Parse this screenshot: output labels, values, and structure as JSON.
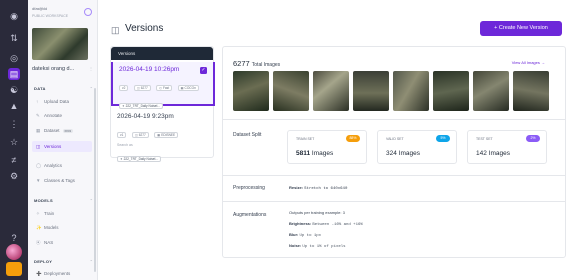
{
  "rail": {
    "icons": [
      "logo-icon",
      "workspaces-icon",
      "universe-icon",
      "projects-icon",
      "models-icon",
      "deploy-icon",
      "workflows-icon",
      "settings-icon"
    ]
  },
  "sidebar": {
    "workspace_label": "dfasfjfdd",
    "workspace_sub": "PUBLIC WORKSPACE",
    "project_name": "dateksi orang d...",
    "data_section": "DATA",
    "data_items": [
      {
        "label": "Upload Data",
        "icon": "upload-icon"
      },
      {
        "label": "Annotate",
        "icon": "annotate-icon"
      },
      {
        "label": "Dataset",
        "icon": "dataset-icon",
        "badge": "6803"
      },
      {
        "label": "Versions",
        "icon": "versions-icon",
        "selected": true
      },
      {
        "label": "Analytics",
        "icon": "analytics-icon"
      },
      {
        "label": "Classes & Tags",
        "icon": "tags-icon"
      }
    ],
    "models_section": "MODELS",
    "models_items": [
      {
        "label": "Train",
        "icon": "train-icon"
      },
      {
        "label": "Models",
        "icon": "models-icon"
      },
      {
        "label": "NAS",
        "icon": "nas-icon"
      }
    ],
    "deploy_section": "DEPLOY",
    "deploy_items": [
      {
        "label": "Deployments",
        "icon": "deployments-icon"
      }
    ]
  },
  "header": {
    "title": "Versions",
    "create_button": "+ Create New Version"
  },
  "versions": {
    "list_header": "Versions",
    "items": [
      {
        "name": "2026-04-19 10:26pm",
        "selected": true,
        "pills": [
          "v2",
          "6277",
          "Fast",
          "COCOn"
        ],
        "tag": "222_TRT_Daily Noisel..."
      },
      {
        "name": "2026-04-19 9:23pm",
        "selected": false,
        "pills": [
          "v1",
          "6277",
          "EDISNEE"
        ],
        "line": "Search as",
        "tag": "222_TRT_Daily Noisel..."
      }
    ]
  },
  "detail": {
    "total_count": "6277",
    "total_label": "Total Images",
    "view_all": "View All Images →",
    "dataset_split_label": "Dataset Split",
    "splits": [
      {
        "label": "TRAIN SET",
        "value": "5811",
        "unit": "Images",
        "badge": "88%",
        "color": "#f59e0b"
      },
      {
        "label": "VALID SET",
        "value": "324",
        "unit": "Images",
        "badge": "5%",
        "color": "#0ea5e9"
      },
      {
        "label": "TEST SET",
        "value": "142",
        "unit": "Images",
        "badge": "2%",
        "color": "#8b5cf6"
      }
    ],
    "preprocessing_label": "Preprocessing",
    "preprocessing_key": "Resize:",
    "preprocessing_value": "Stretch to 640x640",
    "augmentations_label": "Augmentations",
    "aug_lines": [
      {
        "key": "Outputs per training example:",
        "value": "3"
      },
      {
        "key": "Brightness:",
        "value": "Between -16% and +16%"
      },
      {
        "key": "Blur:",
        "value": "Up to 1px"
      },
      {
        "key": "Noise:",
        "value": "Up to 1% of pixels"
      }
    ]
  }
}
